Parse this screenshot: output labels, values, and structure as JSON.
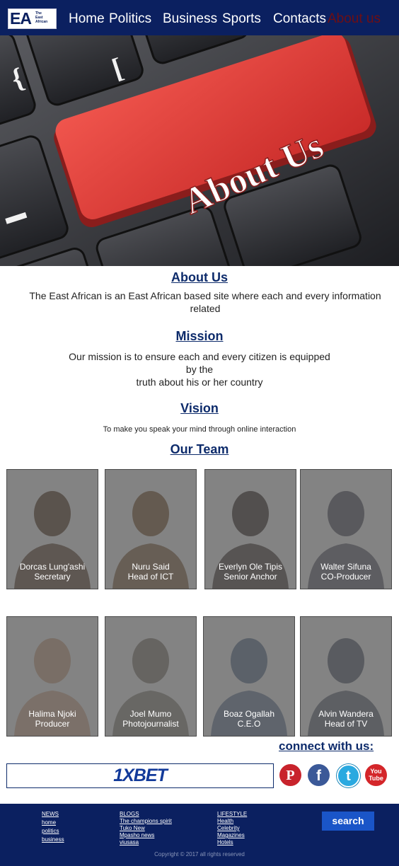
{
  "logo": {
    "letters": "EA",
    "line1": "The",
    "line2": "East",
    "line3": "African"
  },
  "nav": {
    "home": "Home",
    "politics": "Politics",
    "business": "Business",
    "sports": "Sports",
    "contacts": "Contacts",
    "about": "About us"
  },
  "hero": {
    "key_text": "About Us"
  },
  "about": {
    "title": "About Us",
    "text": "The East African is an East African based site where each and every information related"
  },
  "mission": {
    "title": "Mission",
    "line1": "Our mission is to ensure each and every citizen is equipped",
    "line2": "by the",
    "line3": "truth about his or her country"
  },
  "vision": {
    "title": "Vision",
    "text": "To make you speak your mind through  online interaction"
  },
  "team": {
    "title": "Our Team",
    "members": [
      {
        "name": "Dorcas Lung'ashi",
        "role": "Secretary"
      },
      {
        "name": "Nuru Said",
        "role": "Head of ICT"
      },
      {
        "name": "Everlyn Ole Tipis",
        "role": "Senior Anchor"
      },
      {
        "name": "Walter Sifuna",
        "role": "CO-Producer"
      },
      {
        "name": "Halima Njoki",
        "role": "Producer"
      },
      {
        "name": "Joel Mumo",
        "role": "Photojournalist"
      },
      {
        "name": "Boaz Ogallah",
        "role": "C.E.O"
      },
      {
        "name": "Alvin Wandera",
        "role": "Head of  TV"
      }
    ]
  },
  "connect": {
    "title": "connect with us:"
  },
  "ad": {
    "text": "1XBET"
  },
  "social": [
    "pinterest-icon",
    "facebook-icon",
    "twitter-icon",
    "youtube-icon"
  ],
  "social_labels": {
    "pinterest": "P",
    "facebook": "f",
    "twitter": "t",
    "youtube_top": "You",
    "youtube_bottom": "Tube"
  },
  "footer": {
    "news": {
      "heading": "NEWS",
      "items": [
        "home",
        "politics",
        "business"
      ]
    },
    "blogs": {
      "heading": "BLOGS",
      "items": [
        "The champions spirit",
        "Tuko New",
        "Mpasho news",
        "viusasa"
      ]
    },
    "lifestyle": {
      "heading": "LIFESTYLE",
      "items": [
        "Health",
        "Celebrity",
        "Magazines",
        "Hotels"
      ]
    },
    "search_label": "search",
    "copyright": "Copyright © 2017 all rights reserved"
  },
  "colors": {
    "nav_bg": "#0b2060",
    "heading": "#0d2b6b",
    "active_nav": "#6e0e14",
    "key_red": "#e5403c"
  }
}
